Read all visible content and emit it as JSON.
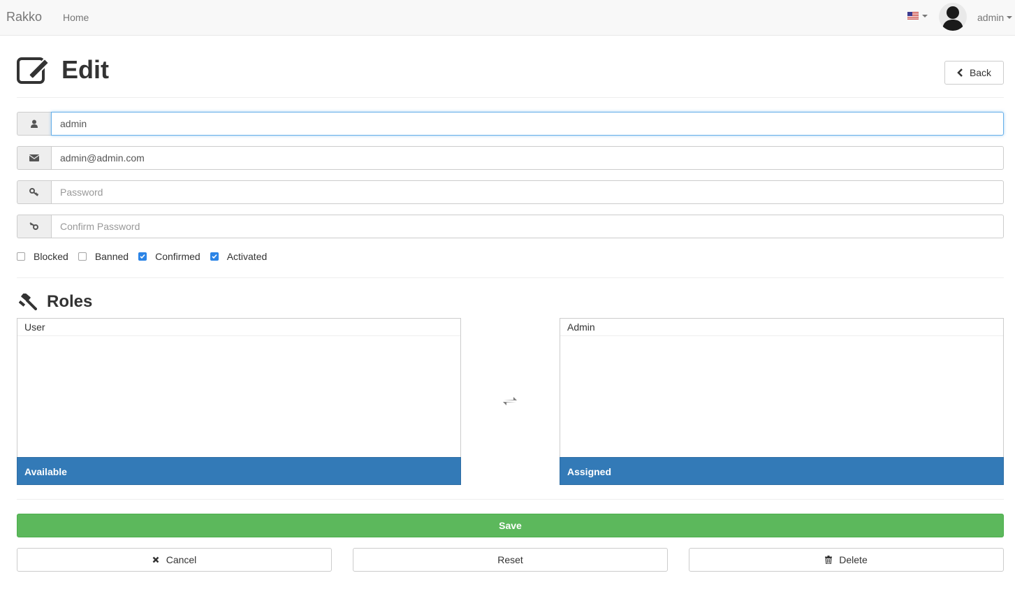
{
  "navbar": {
    "brand": "Rakko",
    "home": "Home",
    "user": "admin"
  },
  "header": {
    "title": "Edit",
    "back_label": "Back"
  },
  "form": {
    "username_value": "admin",
    "email_value": "admin@admin.com",
    "password_placeholder": "Password",
    "confirm_placeholder": "Confirm Password",
    "checkboxes": [
      {
        "label": "Blocked",
        "checked": false
      },
      {
        "label": "Banned",
        "checked": false
      },
      {
        "label": "Confirmed",
        "checked": true
      },
      {
        "label": "Activated",
        "checked": true
      }
    ]
  },
  "roles": {
    "title": "Roles",
    "available": {
      "items": [
        "User"
      ],
      "footer": "Available"
    },
    "assigned": {
      "items": [
        "Admin"
      ],
      "footer": "Assigned"
    }
  },
  "actions": {
    "save": "Save",
    "cancel": "Cancel",
    "reset": "Reset",
    "delete": "Delete"
  },
  "colors": {
    "primary": "#337ab7",
    "success": "#5cb85c",
    "checkbox": "#2b84e6"
  }
}
